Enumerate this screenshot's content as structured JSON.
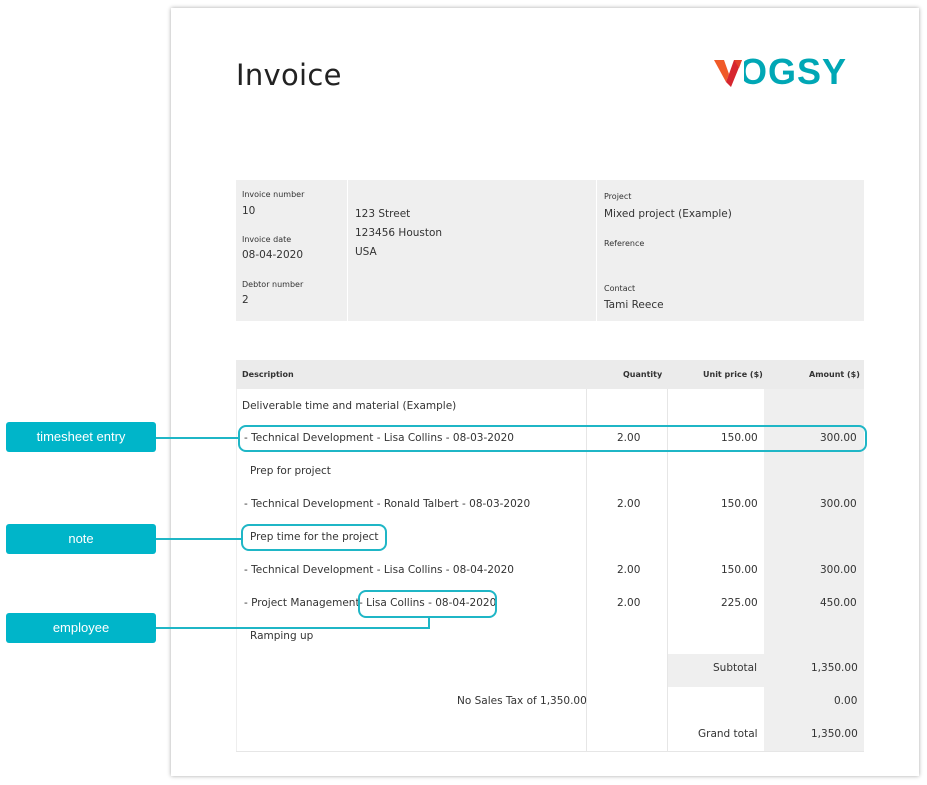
{
  "invoice": {
    "title": "Invoice",
    "logo": "VOGSY",
    "info": {
      "invoice_number_label": "Invoice number",
      "invoice_number": "10",
      "invoice_date_label": "Invoice date",
      "invoice_date": "08-04-2020",
      "debtor_number_label": "Debtor number",
      "debtor_number": "2",
      "address_line1": "123 Street",
      "address_line2": "123456 Houston",
      "address_line3": "USA",
      "project_label": "Project",
      "project": "Mixed project (Example)",
      "reference_label": "Reference",
      "contact_label": "Contact",
      "contact": "Tami Reece"
    },
    "table": {
      "headers": {
        "description": "Description",
        "quantity": "Quantity",
        "unit_price": "Unit price ($)",
        "amount": "Amount ($)"
      },
      "rows": [
        {
          "description": "Deliverable time and material (Example)",
          "quantity": "",
          "unit_price": "",
          "amount": ""
        },
        {
          "description": "- Technical Development - Lisa Collins - 08-03-2020",
          "quantity": "2.00",
          "unit_price": "150.00",
          "amount": "300.00"
        },
        {
          "description": "Prep for project",
          "quantity": "",
          "unit_price": "",
          "amount": ""
        },
        {
          "description": "- Technical Development - Ronald Talbert - 08-03-2020",
          "quantity": "2.00",
          "unit_price": "150.00",
          "amount": "300.00"
        },
        {
          "description": "Prep time for the project",
          "quantity": "",
          "unit_price": "",
          "amount": ""
        },
        {
          "description": "- Technical Development - Lisa Collins - 08-04-2020",
          "quantity": "2.00",
          "unit_price": "150.00",
          "amount": "300.00"
        },
        {
          "description_prefix": "- Project Management ",
          "description_employee": "- Lisa Collins - 08-04-2020",
          "quantity": "2.00",
          "unit_price": "225.00",
          "amount": "450.00"
        },
        {
          "description": "Ramping up",
          "quantity": "",
          "unit_price": "",
          "amount": ""
        }
      ],
      "subtotal_label": "Subtotal",
      "subtotal": "1,350.00",
      "tax_label": "No Sales Tax of 1,350.00",
      "tax": "0.00",
      "grand_total_label": "Grand total",
      "grand_total": "1,350.00"
    }
  },
  "callouts": {
    "timesheet_entry": "timesheet entry",
    "note": "note",
    "employee": "employee"
  },
  "colors": {
    "accent": "#00b5c9",
    "logo_teal": "#00a7b5",
    "logo_orange": "#f05a28",
    "logo_red": "#d6262f"
  }
}
